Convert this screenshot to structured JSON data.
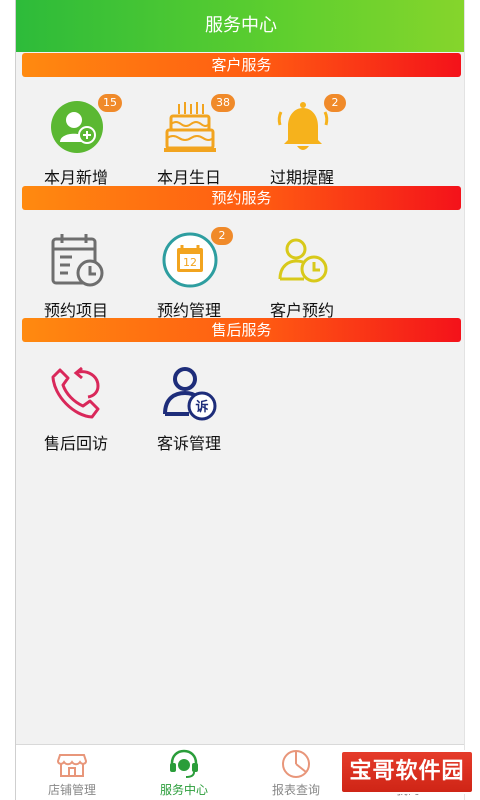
{
  "header": {
    "title": "服务中心"
  },
  "sections": [
    {
      "title": "客户服务",
      "items": [
        {
          "label": "本月新增",
          "badge": "15",
          "icon": "add-user-icon"
        },
        {
          "label": "本月生日",
          "badge": "38",
          "icon": "birthday-cake-icon"
        },
        {
          "label": "过期提醒",
          "badge": "2",
          "icon": "bell-icon"
        }
      ]
    },
    {
      "title": "预约服务",
      "items": [
        {
          "label": "预约项目",
          "icon": "calendar-clock-icon"
        },
        {
          "label": "预约管理",
          "badge": "2",
          "calendar_day": "12",
          "icon": "calendar-day-icon"
        },
        {
          "label": "客户预约",
          "icon": "user-clock-icon"
        }
      ]
    },
    {
      "title": "售后服务",
      "items": [
        {
          "label": "售后回访",
          "icon": "phone-callback-icon"
        },
        {
          "label": "客诉管理",
          "badge_text": "诉",
          "icon": "complaint-user-icon"
        }
      ]
    }
  ],
  "tabs": [
    {
      "label": "店铺管理",
      "icon": "store-icon"
    },
    {
      "label": "服务中心",
      "icon": "headset-icon",
      "active": true
    },
    {
      "label": "报表查询",
      "icon": "pie-chart-icon"
    },
    {
      "label": "我的",
      "icon": "profile-icon"
    }
  ],
  "watermark": "宝哥软件园",
  "colors": {
    "header": "#2dbb3a",
    "section": "#ff5a12",
    "badge": "#f08a2a",
    "active_tab": "#2a9d3a"
  }
}
